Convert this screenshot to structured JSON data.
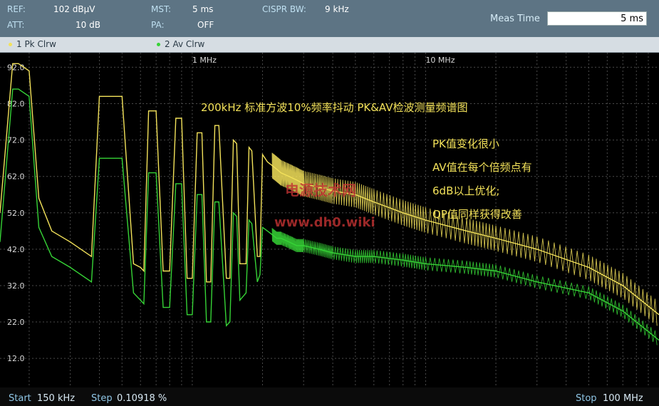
{
  "header": {
    "ref_label": "REF:",
    "ref_value": "102 dBµV",
    "att_label": "ATT:",
    "att_value": "10 dB",
    "mst_label": "MST:",
    "mst_value": "5 ms",
    "pa_label": "PA:",
    "pa_value": "OFF",
    "cispr_label": "CISPR BW:",
    "cispr_value": "9 kHz",
    "meas_time_label": "Meas Time",
    "meas_time_value": "5 ms"
  },
  "traces": [
    {
      "label": "1 Pk  Clrw",
      "color": "#f3e25a"
    },
    {
      "label": "2 Av  Clrw",
      "color": "#36d336"
    }
  ],
  "footer": {
    "start_label": "Start",
    "start_value": "150 kHz",
    "step_label": "Step",
    "step_value": "0.10918 %",
    "stop_label": "Stop",
    "stop_value": "100 MHz"
  },
  "annotations": {
    "title": "200kHz 标准方波10%频率抖动 PK&AV检波测量频谱图",
    "notes": [
      "PK值变化很小",
      "AV值在每个倍频点有",
      "6dB以上优化;",
      "QP值同样获得改善"
    ],
    "watermark_1": "电源技术网",
    "watermark_2": "www.dh0.wiki"
  },
  "chart_data": {
    "type": "line",
    "x_scale": "log",
    "x_ticks": [
      "1 MHz",
      "10 MHz"
    ],
    "y_ticks": [
      "92.0",
      "82.0",
      "72.0",
      "62.0",
      "52.0",
      "42.0",
      "32.0",
      "22.0",
      "12.0"
    ],
    "ylim": [
      4,
      96
    ],
    "xlim_mhz": [
      0.15,
      100
    ],
    "x_mhz": [
      0.15,
      0.17,
      0.18,
      0.2,
      0.22,
      0.25,
      0.3,
      0.37,
      0.4,
      0.5,
      0.56,
      0.6,
      0.62,
      0.65,
      0.7,
      0.75,
      0.8,
      0.85,
      0.9,
      0.95,
      1.0,
      1.05,
      1.1,
      1.15,
      1.2,
      1.25,
      1.3,
      1.4,
      1.45,
      1.5,
      1.55,
      1.6,
      1.7,
      1.75,
      1.8,
      1.9,
      1.95,
      2.0,
      2.1,
      2.2,
      2.3,
      2.4,
      2.6,
      2.8,
      3,
      3.5,
      4,
      5,
      6,
      8,
      10,
      15,
      20,
      30,
      50,
      70,
      100
    ],
    "series": [
      {
        "name": "1 Pk Clrw",
        "color": "#f3e25a",
        "values": [
          52,
          93,
          93,
          91,
          56,
          47,
          44,
          40,
          84,
          84,
          38,
          37,
          36,
          80,
          80,
          36,
          36,
          78,
          78,
          34,
          34,
          74,
          74,
          33,
          33,
          76,
          76,
          34,
          34,
          72,
          71,
          38,
          38,
          70,
          69,
          40,
          40,
          68,
          66,
          65,
          64,
          63,
          62,
          61,
          60,
          59,
          58,
          57,
          55,
          52,
          50,
          47,
          45,
          42,
          37,
          32,
          24
        ]
      },
      {
        "name": "2 Av Clrw",
        "color": "#36d336",
        "values": [
          44,
          86,
          86,
          84,
          48,
          40,
          37,
          33,
          67,
          67,
          30,
          28,
          27,
          63,
          63,
          26,
          26,
          60,
          60,
          24,
          24,
          57,
          57,
          22,
          22,
          55,
          55,
          21,
          22,
          52,
          51,
          28,
          30,
          50,
          49,
          33,
          35,
          48,
          47,
          46,
          45,
          45,
          44,
          43,
          43,
          42,
          41,
          40,
          40,
          39,
          38,
          37,
          36,
          33,
          30,
          25,
          17
        ]
      }
    ]
  }
}
